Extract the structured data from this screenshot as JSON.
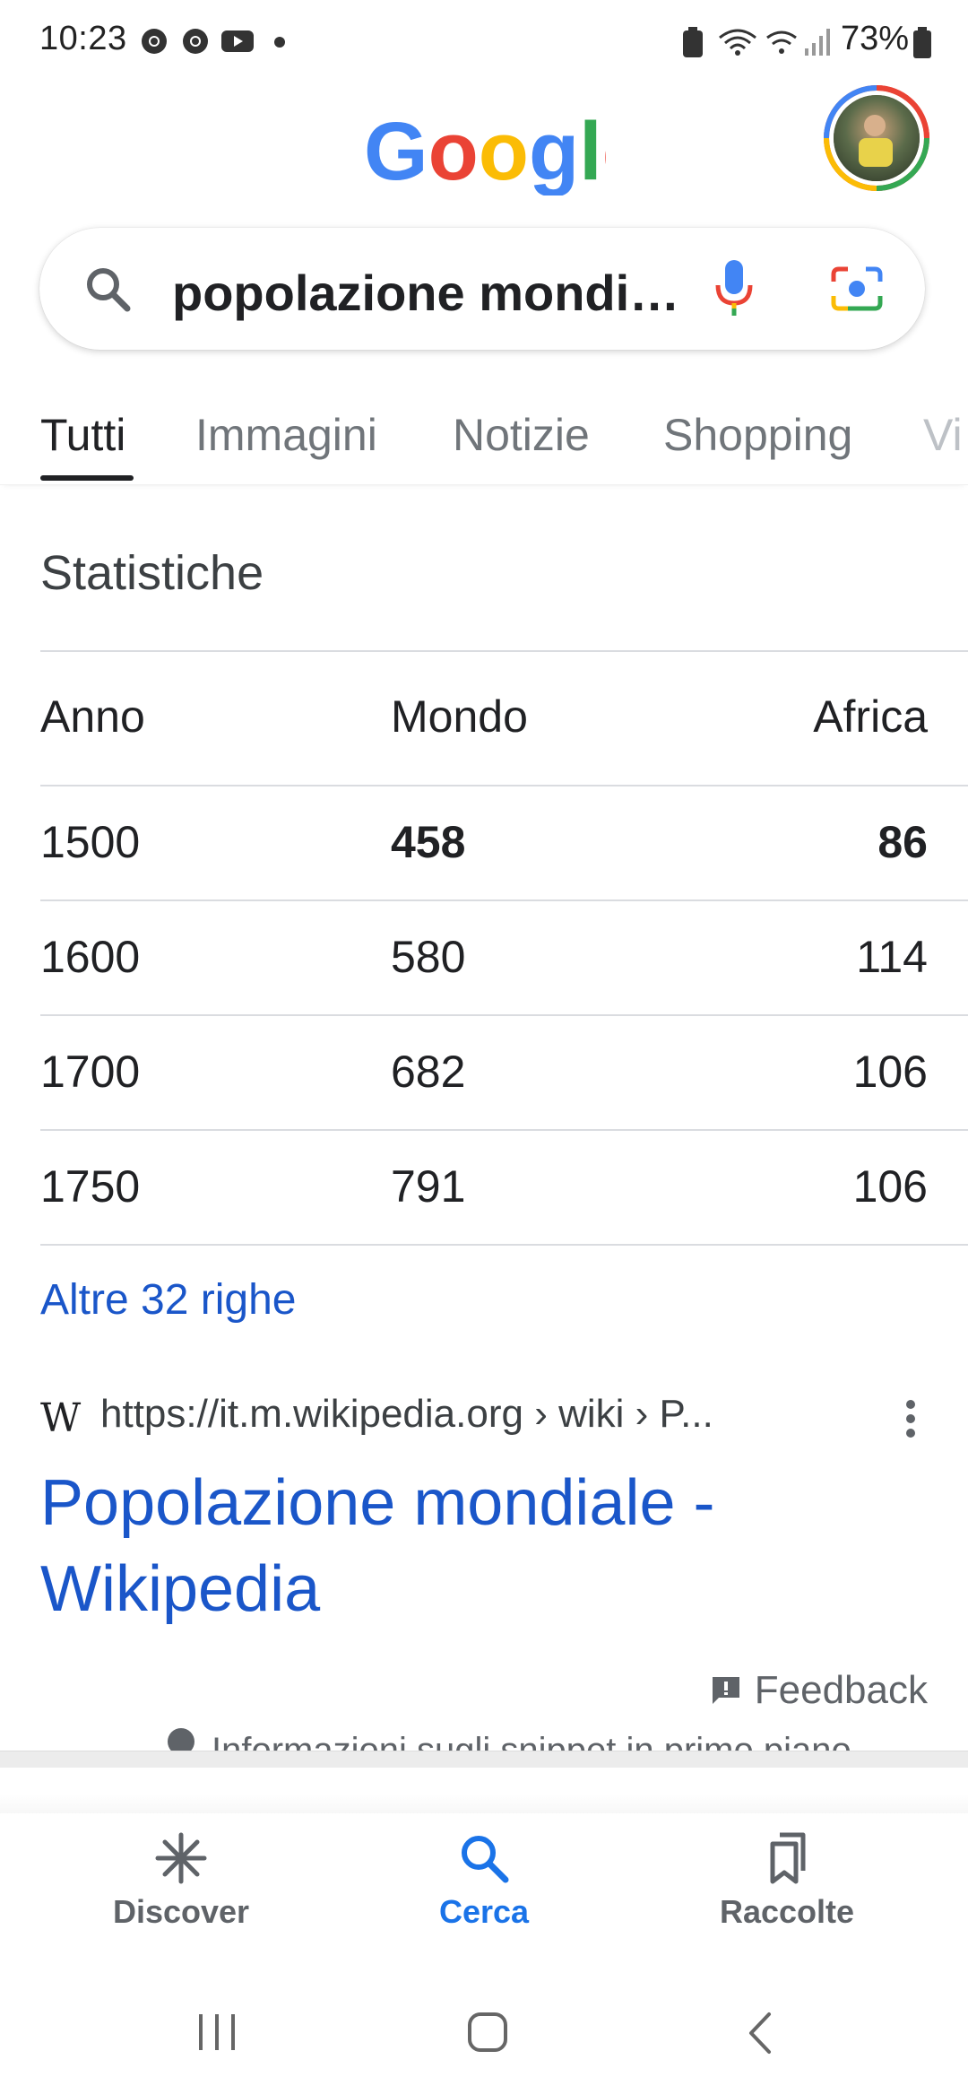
{
  "status_bar": {
    "time": "10:23",
    "battery": "73%"
  },
  "header": {
    "logo_text": "Google"
  },
  "search": {
    "query": "popolazione mondi…"
  },
  "tabs": [
    {
      "label": "Tutti"
    },
    {
      "label": "Immagini"
    },
    {
      "label": "Notizie"
    },
    {
      "label": "Shopping"
    },
    {
      "label": "Vi"
    }
  ],
  "stats": {
    "title": "Statistiche",
    "columns": [
      "Anno",
      "Mondo",
      "Africa"
    ],
    "rows": [
      [
        "1500",
        "458",
        "86"
      ],
      [
        "1600",
        "580",
        "114"
      ],
      [
        "1700",
        "682",
        "106"
      ],
      [
        "1750",
        "791",
        "106"
      ]
    ],
    "more_link": "Altre 32 righe"
  },
  "result": {
    "favicon": "W",
    "url": "https://it.m.wikipedia.org › wiki › P...",
    "title_line1": "Popolazione mondiale -",
    "title_line2": "Wikipedia"
  },
  "feedback": "Feedback",
  "snippet_info": "Informazioni sugli snippet in primo piano",
  "bottom_nav": [
    {
      "label": "Discover",
      "icon": "asterisk-icon"
    },
    {
      "label": "Cerca",
      "icon": "search-icon"
    },
    {
      "label": "Raccolte",
      "icon": "bookmarks-icon"
    }
  ],
  "colors": {
    "link": "#1a56c9",
    "active_nav": "#1a73e8"
  }
}
